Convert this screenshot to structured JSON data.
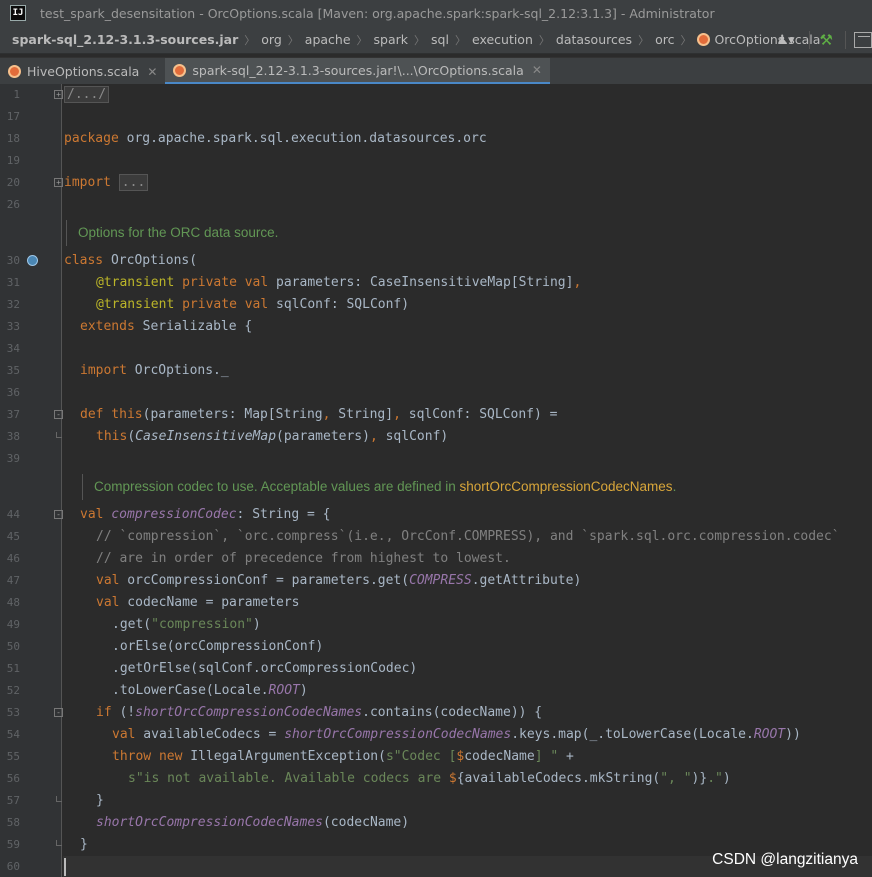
{
  "window": {
    "title": "test_spark_desensitation - OrcOptions.scala [Maven: org.apache.spark:spark-sql_2.12:3.1.3] - Administrator",
    "logo_text": "IJ"
  },
  "breadcrumb": [
    "spark-sql_2.12-3.1.3-sources.jar",
    "org",
    "apache",
    "spark",
    "sql",
    "execution",
    "datasources",
    "orc",
    "OrcOptions.scala"
  ],
  "tabs": [
    {
      "label": "HiveOptions.scala",
      "active": false
    },
    {
      "label": "spark-sql_2.12-3.1.3-sources.jar!\\...\\OrcOptions.scala",
      "active": true
    }
  ],
  "editor": {
    "line_numbers": [
      "1",
      "17",
      "18",
      "19",
      "20",
      "26",
      "30",
      "31",
      "32",
      "33",
      "34",
      "35",
      "36",
      "37",
      "38",
      "39",
      "44",
      "45",
      "46",
      "47",
      "48",
      "49",
      "50",
      "51",
      "52",
      "53",
      "54",
      "55",
      "56",
      "57",
      "58",
      "59",
      "60"
    ],
    "doc_comments": {
      "class_doc": "Options for the ORC data source.",
      "codec_doc_prefix": "Compression codec to use. Acceptable values are defined in ",
      "codec_doc_link": "shortOrcCompressionCodecNames",
      "codec_doc_suffix": "."
    },
    "code": {
      "l1": "/.../",
      "l18_kw": "package",
      "l18_rest": " org.apache.spark.sql.execution.datasources.orc",
      "l20_kw": "import",
      "l20_fold": "...",
      "l30_kw": "class",
      "l30_rest": " OrcOptions(",
      "l31_ann": "@transient",
      "l31_kw": " private val",
      "l31_rest": " parameters: CaseInsensitiveMap[String]",
      "l31_comma": ",",
      "l32_ann": "@transient",
      "l32_kw": " private val",
      "l32_rest": " sqlConf: SQLConf)",
      "l33_kw": "extends",
      "l33_rest": " Serializable {",
      "l35_kw": "import",
      "l35_rest": " OrcOptions._",
      "l37_kw": "def",
      "l37_this": " this",
      "l37_rest1": "(parameters: Map[String",
      "l37_comma": ",",
      "l37_rest2": " String]",
      "l37_comma2": ",",
      "l37_rest3": " sqlConf: SQLConf) =",
      "l38_kw": "this",
      "l38_a": "(",
      "l38_italic": "CaseInsensitiveMap",
      "l38_b": "(parameters)",
      "l38_comma": ",",
      "l38_c": " sqlConf)",
      "l44_kw": "val",
      "l44_field": " compressionCodec",
      "l44_rest": ": String = {",
      "l45": "// `compression`, `orc.compress`(i.e., OrcConf.COMPRESS), and `spark.sql.orc.compression.codec`",
      "l46": "// are in order of precedence from highest to lowest.",
      "l47_kw": "val",
      "l47_a": " orcCompressionConf = parameters.get(",
      "l47_f": "COMPRESS",
      "l47_b": ".getAttribute)",
      "l48_kw": "val",
      "l48_rest": " codecName = parameters",
      "l49_a": ".get(",
      "l49_s": "\"compression\"",
      "l49_b": ")",
      "l50": ".orElse(orcCompressionConf)",
      "l51": ".getOrElse(sqlConf.orcCompressionCodec)",
      "l52_a": ".toLowerCase(Locale.",
      "l52_f": "ROOT",
      "l52_b": ")",
      "l53_kw": "if",
      "l53_a": " (!",
      "l53_f": "shortOrcCompressionCodecNames",
      "l53_b": ".contains(codecName)) {",
      "l54_kw": "val",
      "l54_a": " availableCodecs = ",
      "l54_f": "shortOrcCompressionCodecNames",
      "l54_b": ".keys.map(_.toLowerCase(Locale.",
      "l54_f2": "ROOT",
      "l54_c": "))",
      "l55_kw": "throw new",
      "l55_a": " IllegalArgumentException(",
      "l55_s1": "s\"Codec [",
      "l55_d": "$",
      "l55_v": "codecName",
      "l55_s2": "] \"",
      "l55_b": " +",
      "l56_s1": "s\"is not available. Available codecs are ",
      "l56_d": "$",
      "l56_a": "{availableCodecs.mkString(",
      "l56_s2": "\", \"",
      "l56_b": ")}",
      "l56_s3": ".\"",
      "l56_c": ")",
      "l57": "}",
      "l58_f": "shortOrcCompressionCodecNames",
      "l58_rest": "(codecName)",
      "l59": "}"
    }
  },
  "watermark": "CSDN @langzitianya",
  "colors": {
    "keyword": "#cc7832",
    "string": "#6a8759",
    "comment": "#808080",
    "annotation": "#bbb529",
    "field": "#9876aa",
    "doc": "#629755",
    "text": "#a9b7c6"
  }
}
